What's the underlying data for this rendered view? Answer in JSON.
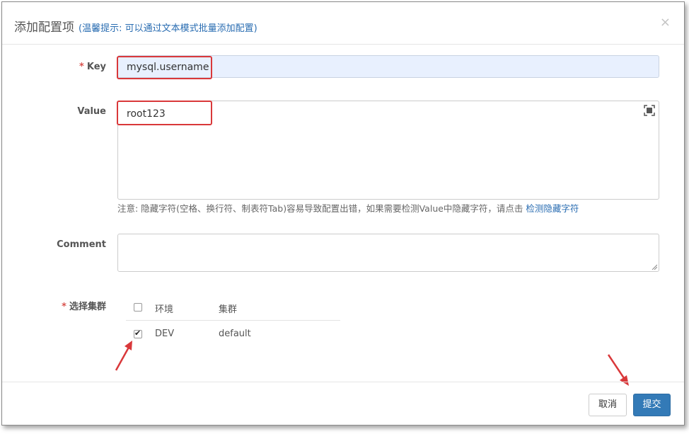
{
  "dialog": {
    "title": "添加配置项",
    "hint": "(温馨提示: 可以通过文本模式批量添加配置)",
    "close_symbol": "×"
  },
  "form": {
    "key": {
      "required_mark": "*",
      "label": "Key",
      "value": "mysql.username"
    },
    "value": {
      "label": "Value",
      "value": "root123"
    },
    "note": {
      "text": "注意: 隐藏字符(空格、换行符、制表符Tab)容易导致配置出错，如果需要检测Value中隐藏字符，请点击",
      "link": "检测隐藏字符"
    },
    "comment": {
      "label": "Comment",
      "value": ""
    },
    "cluster": {
      "required_mark": "*",
      "label": "选择集群",
      "headers": {
        "env": "环境",
        "cluster": "集群"
      },
      "rows": [
        {
          "env": "DEV",
          "cluster": "default",
          "checked": true
        }
      ]
    }
  },
  "footer": {
    "cancel_label": "取消",
    "submit_label": "提交"
  },
  "colors": {
    "primary": "#337ab7",
    "highlight": "#d9383a",
    "link": "#2a6db2"
  }
}
